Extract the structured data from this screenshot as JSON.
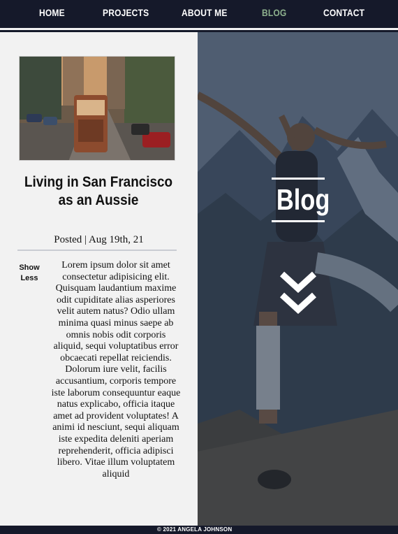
{
  "nav": {
    "items": [
      {
        "label": "HOME"
      },
      {
        "label": "PROJECTS"
      },
      {
        "label": "ABOUT ME"
      },
      {
        "label": "BLOG"
      },
      {
        "label": "CONTACT"
      }
    ],
    "active_index": 3,
    "colors": {
      "background": "#15192a",
      "text": "#ffffff",
      "active": "#8db08d"
    }
  },
  "post": {
    "title": "Living in San Francisco as an Aussie",
    "posted": "Posted | Aug 19th, 21",
    "toggle_label": "Show Less",
    "body": "Lorem ipsum dolor sit amet consectetur adipisicing elit. Quisquam laudantium maxime odit cupiditate alias asperiores velit autem natus? Odio ullam minima quasi minus saepe ab omnis nobis odit corporis aliquid, sequi voluptatibus error obcaecati repellat reiciendis. Dolorum iure velit, facilis accusantium, corporis tempore iste laborum consequuntur eaque natus explicabo, officia itaque amet ad provident voluptates! A animi id nesciunt, sequi aliquam iste expedita deleniti aperiam reprehenderit, officia adipisci libero. Vitae illum voluptatem aliquid",
    "image_icon": "san-francisco-cable-car-photo"
  },
  "hero": {
    "title": "Blog",
    "scroll_icon": "double-chevron-down-icon",
    "image_icon": "hiker-on-mountain-photo"
  },
  "footer": {
    "text": "© 2021 ANGELA JOHNSON"
  }
}
